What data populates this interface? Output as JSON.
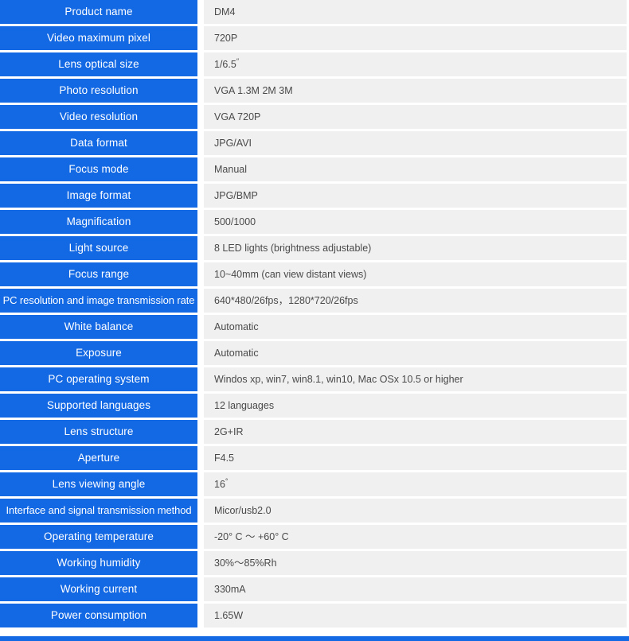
{
  "table": {
    "accent_color": "#1368e4",
    "value_background": "#f0f0f0",
    "value_text_color": "#4a4a4a",
    "label_text_color": "#ffffff",
    "rows": [
      {
        "label": "Product name",
        "value": "DM4"
      },
      {
        "label": "Video maximum pixel",
        "value": "720P"
      },
      {
        "label": "Lens optical size",
        "value": "1/6.5",
        "value_sup": "″"
      },
      {
        "label": "Photo resolution",
        "value": "VGA   1.3M   2M   3M"
      },
      {
        "label": "Video resolution",
        "value": "VGA   720P"
      },
      {
        "label": "Data format",
        "value": "JPG/AVI"
      },
      {
        "label": "Focus mode",
        "value": "Manual"
      },
      {
        "label": "Image format",
        "value": "JPG/BMP"
      },
      {
        "label": "Magnification",
        "value": "500/1000"
      },
      {
        "label": "Light source",
        "value": "8 LED lights (brightness adjustable)"
      },
      {
        "label": "Focus range",
        "value": "10~40mm (can view distant views)"
      },
      {
        "label": "PC resolution and image transmission rate",
        "value": "640*480/26fps，1280*720/26fps"
      },
      {
        "label": "White balance",
        "value": "Automatic"
      },
      {
        "label": "Exposure",
        "value": "Automatic"
      },
      {
        "label": "PC operating system",
        "value": "Windos xp, win7, win8.1, win10, Mac OSx 10.5 or higher"
      },
      {
        "label": "Supported languages",
        "value": "12 languages"
      },
      {
        "label": "Lens structure",
        "value": "2G+IR"
      },
      {
        "label": "Aperture",
        "value": "F4.5"
      },
      {
        "label": "Lens viewing angle",
        "value": "16",
        "value_sup": "°"
      },
      {
        "label": "Interface and signal transmission method",
        "value": "Micor/usb2.0"
      },
      {
        "label": "Operating temperature",
        "value": "-20° C ～ +60° C"
      },
      {
        "label": "Working humidity",
        "value": "30%～85%Rh"
      },
      {
        "label": "Working current",
        "value": "330mA"
      },
      {
        "label": "Power consumption",
        "value": "1.65W"
      }
    ]
  },
  "footer": {
    "divider_color": "#1368e4"
  }
}
